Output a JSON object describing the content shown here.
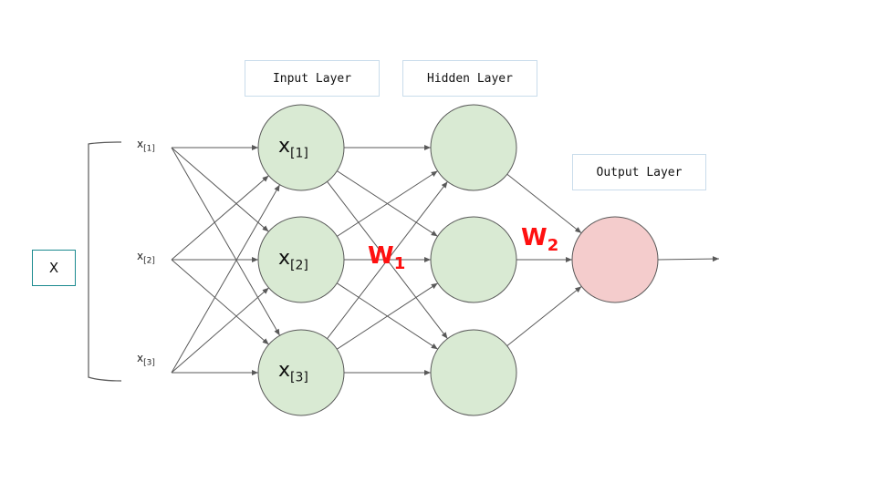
{
  "layers": {
    "input": "Input Layer",
    "hidden": "Hidden Layer",
    "output": "Output Layer"
  },
  "input_vector_label": "X",
  "input_features": [
    {
      "base": "x",
      "index": "[1]"
    },
    {
      "base": "x",
      "index": "[2]"
    },
    {
      "base": "x",
      "index": "[3]"
    }
  ],
  "input_nodes": [
    {
      "base": "x",
      "index": "[1]"
    },
    {
      "base": "x",
      "index": "[2]"
    },
    {
      "base": "x",
      "index": "[3]"
    }
  ],
  "weights": [
    {
      "base": "W",
      "index": "1"
    },
    {
      "base": "W",
      "index": "2"
    }
  ],
  "colors": {
    "input_node_fill": "#d9ead3",
    "hidden_node_fill": "#d9ead3",
    "output_node_fill": "#f4cccc",
    "node_stroke": "#595959",
    "edge": "#595959",
    "weight_text": "#ff0000",
    "x_box_border": "#1a8a8f",
    "layer_box_border": "#c9dceb"
  }
}
